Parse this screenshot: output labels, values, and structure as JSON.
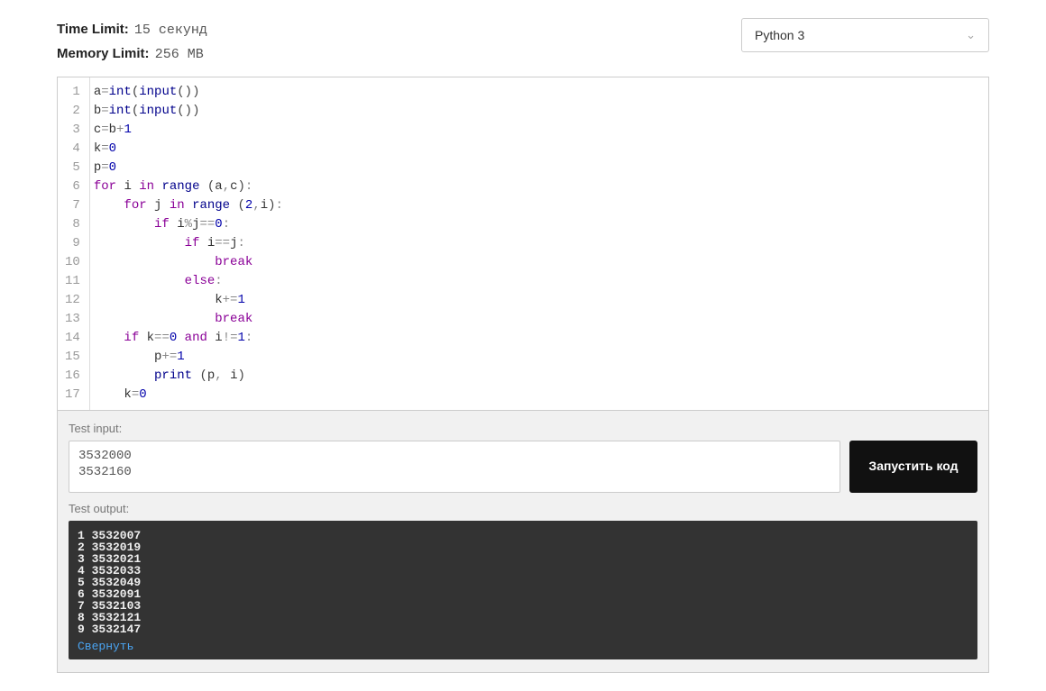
{
  "limits": {
    "time_label": "Time Limit:",
    "time_value": "15 секунд",
    "memory_label": "Memory Limit:",
    "memory_value": "256 MB"
  },
  "language": {
    "selected": "Python 3"
  },
  "code_lines": [
    [
      [
        "id",
        "a"
      ],
      [
        "op",
        "="
      ],
      [
        "fn",
        "int"
      ],
      [
        "par",
        "("
      ],
      [
        "fn",
        "input"
      ],
      [
        "par",
        "("
      ],
      [
        "par",
        ")"
      ],
      [
        "par",
        ")"
      ]
    ],
    [
      [
        "id",
        "b"
      ],
      [
        "op",
        "="
      ],
      [
        "fn",
        "int"
      ],
      [
        "par",
        "("
      ],
      [
        "fn",
        "input"
      ],
      [
        "par",
        "("
      ],
      [
        "par",
        ")"
      ],
      [
        "par",
        ")"
      ]
    ],
    [
      [
        "id",
        "c"
      ],
      [
        "op",
        "="
      ],
      [
        "id",
        "b"
      ],
      [
        "op",
        "+"
      ],
      [
        "num",
        "1"
      ]
    ],
    [
      [
        "id",
        "k"
      ],
      [
        "op",
        "="
      ],
      [
        "num",
        "0"
      ]
    ],
    [
      [
        "id",
        "p"
      ],
      [
        "op",
        "="
      ],
      [
        "num",
        "0"
      ]
    ],
    [
      [
        "kw",
        "for"
      ],
      [
        "sp",
        " "
      ],
      [
        "id",
        "i"
      ],
      [
        "sp",
        " "
      ],
      [
        "kw",
        "in"
      ],
      [
        "sp",
        " "
      ],
      [
        "fn",
        "range"
      ],
      [
        "sp",
        " "
      ],
      [
        "par",
        "("
      ],
      [
        "id",
        "a"
      ],
      [
        "op",
        ","
      ],
      [
        "id",
        "c"
      ],
      [
        "par",
        ")"
      ],
      [
        "op",
        ":"
      ]
    ],
    [
      [
        "sp",
        "    "
      ],
      [
        "kw",
        "for"
      ],
      [
        "sp",
        " "
      ],
      [
        "id",
        "j"
      ],
      [
        "sp",
        " "
      ],
      [
        "kw",
        "in"
      ],
      [
        "sp",
        " "
      ],
      [
        "fn",
        "range"
      ],
      [
        "sp",
        " "
      ],
      [
        "par",
        "("
      ],
      [
        "num",
        "2"
      ],
      [
        "op",
        ","
      ],
      [
        "id",
        "i"
      ],
      [
        "par",
        ")"
      ],
      [
        "op",
        ":"
      ]
    ],
    [
      [
        "sp",
        "        "
      ],
      [
        "kw",
        "if"
      ],
      [
        "sp",
        " "
      ],
      [
        "id",
        "i"
      ],
      [
        "op",
        "%"
      ],
      [
        "id",
        "j"
      ],
      [
        "op",
        "=="
      ],
      [
        "num",
        "0"
      ],
      [
        "op",
        ":"
      ]
    ],
    [
      [
        "sp",
        "            "
      ],
      [
        "kw",
        "if"
      ],
      [
        "sp",
        " "
      ],
      [
        "id",
        "i"
      ],
      [
        "op",
        "=="
      ],
      [
        "id",
        "j"
      ],
      [
        "op",
        ":"
      ]
    ],
    [
      [
        "sp",
        "                "
      ],
      [
        "kw",
        "break"
      ]
    ],
    [
      [
        "sp",
        "            "
      ],
      [
        "kw",
        "else"
      ],
      [
        "op",
        ":"
      ]
    ],
    [
      [
        "sp",
        "                "
      ],
      [
        "id",
        "k"
      ],
      [
        "op",
        "+="
      ],
      [
        "num",
        "1"
      ]
    ],
    [
      [
        "sp",
        "                "
      ],
      [
        "kw",
        "break"
      ]
    ],
    [
      [
        "sp",
        "    "
      ],
      [
        "kw",
        "if"
      ],
      [
        "sp",
        " "
      ],
      [
        "id",
        "k"
      ],
      [
        "op",
        "=="
      ],
      [
        "num",
        "0"
      ],
      [
        "sp",
        " "
      ],
      [
        "kw",
        "and"
      ],
      [
        "sp",
        " "
      ],
      [
        "id",
        "i"
      ],
      [
        "op",
        "!="
      ],
      [
        "num",
        "1"
      ],
      [
        "op",
        ":"
      ]
    ],
    [
      [
        "sp",
        "        "
      ],
      [
        "id",
        "p"
      ],
      [
        "op",
        "+="
      ],
      [
        "num",
        "1"
      ]
    ],
    [
      [
        "sp",
        "        "
      ],
      [
        "fn",
        "print"
      ],
      [
        "sp",
        " "
      ],
      [
        "par",
        "("
      ],
      [
        "id",
        "p"
      ],
      [
        "op",
        ","
      ],
      [
        "sp",
        " "
      ],
      [
        "id",
        "i"
      ],
      [
        "par",
        ")"
      ]
    ],
    [
      [
        "sp",
        "    "
      ],
      [
        "id",
        "k"
      ],
      [
        "op",
        "="
      ],
      [
        "num",
        "0"
      ]
    ]
  ],
  "test": {
    "input_label": "Test input:",
    "input_value": "3532000\n3532160",
    "run_label": "Запустить код",
    "output_label": "Test output:",
    "output_lines": [
      "1 3532007",
      "2 3532019",
      "3 3532021",
      "4 3532033",
      "5 3532049",
      "6 3532091",
      "7 3532103",
      "8 3532121",
      "9 3532147"
    ],
    "collapse_label": "Свернуть"
  }
}
